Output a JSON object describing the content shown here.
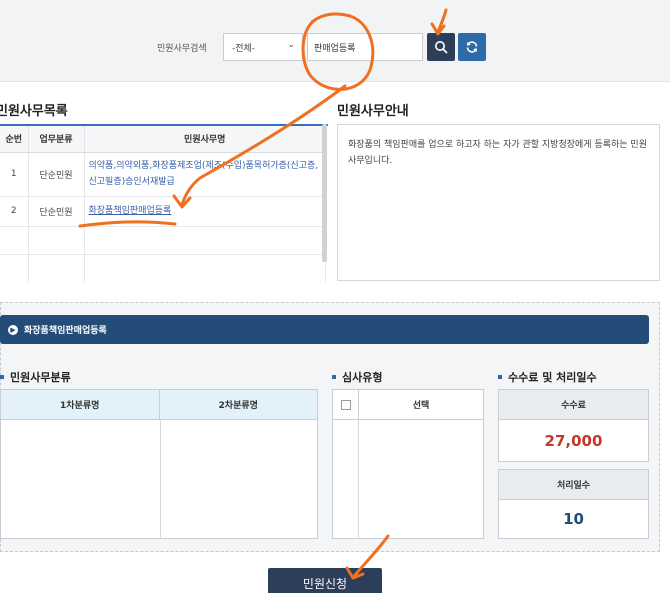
{
  "search": {
    "label": "민원사무검색",
    "select_value": "-전체-",
    "input_value": "판매업등록"
  },
  "list": {
    "title": "민원사무목록",
    "columns": [
      "순번",
      "업무분류",
      "민원사무명"
    ],
    "rows": [
      {
        "no": "1",
        "category": "단순민원",
        "name": "의약품,의약외품,화장품제조업(제조(수입)품목허가증(신고증,신고필증)승인서재발급"
      },
      {
        "no": "2",
        "category": "단순민원",
        "name": "화장품책임판매업등록"
      }
    ]
  },
  "info": {
    "title": "민원사무안내",
    "text": "화장품의 책임판매를 업으로 하고자 하는 자가 관할 지방청장에게 등록하는 민원사무입니다."
  },
  "banner": {
    "label": "화장품책임판매업등록"
  },
  "classification": {
    "title": "민원사무분류",
    "col1": "1차분류명",
    "col2": "2차분류명"
  },
  "review": {
    "title": "심사유형",
    "col_select": "선택"
  },
  "fee": {
    "title": "수수료 및 처리일수",
    "fee_label": "수수료",
    "fee_value": "27,000",
    "days_label": "처리일수",
    "days_value": "10"
  },
  "apply_button": "민원신청",
  "colors": {
    "navy": "#2c3e5a",
    "blue": "#2f6aa8",
    "banner": "#234c79",
    "fee_red": "#c0392b",
    "days_blue": "#234c79",
    "annotation": "#f07020"
  }
}
